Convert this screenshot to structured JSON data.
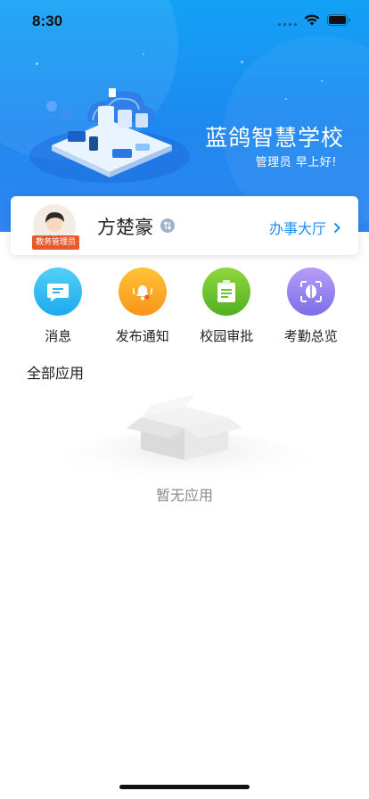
{
  "status_bar": {
    "time": "8:30"
  },
  "header": {
    "school_name": "蓝鸽智慧学校",
    "greeting": "管理员 早上好!"
  },
  "profile": {
    "name": "方楚豪",
    "role_badge": "教务管理员",
    "action_label": "办事大厅"
  },
  "quick_apps": [
    {
      "label": "消息",
      "icon": "message-icon",
      "color": "#2cb5f1"
    },
    {
      "label": "发布通知",
      "icon": "bell-icon",
      "color": "#f7a21b"
    },
    {
      "label": "校园审批",
      "icon": "clipboard-icon",
      "color": "#6cc22f"
    },
    {
      "label": "考勤总览",
      "icon": "face-scan-icon",
      "color": "#8d7cf0"
    }
  ],
  "apps_section": {
    "title": "全部应用",
    "empty_text": "暂无应用"
  },
  "colors": {
    "header_blue": "#1e88f0",
    "link_blue": "#1f8ef0",
    "badge_orange": "#e85a2b"
  }
}
